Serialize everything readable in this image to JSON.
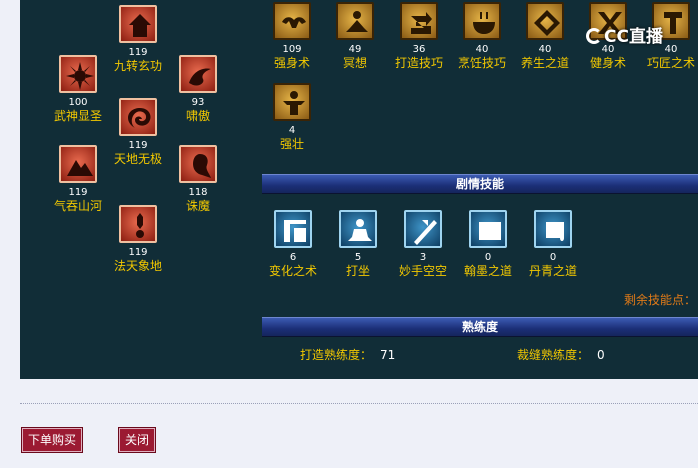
{
  "left_skills": [
    {
      "level": "119",
      "name": "九转玄功",
      "icon": "fortress-icon"
    },
    {
      "level": "100",
      "name": "武神显圣",
      "icon": "sun-burst-icon"
    },
    {
      "level": "93",
      "name": "啸傲",
      "icon": "dragon-icon"
    },
    {
      "level": "119",
      "name": "天地无极",
      "icon": "swirl-icon"
    },
    {
      "level": "119",
      "name": "气吞山河",
      "icon": "mountain-icon"
    },
    {
      "level": "118",
      "name": "诛魔",
      "icon": "ghost-icon"
    },
    {
      "level": "119",
      "name": "法天象地",
      "icon": "amulet-icon"
    }
  ],
  "life_skills": [
    {
      "level": "109",
      "name": "强身术",
      "icon": "muscle-icon"
    },
    {
      "level": "49",
      "name": "冥想",
      "icon": "meditate-icon"
    },
    {
      "level": "36",
      "name": "打造技巧",
      "icon": "forge-icon"
    },
    {
      "level": "40",
      "name": "烹饪技巧",
      "icon": "cooking-icon"
    },
    {
      "level": "40",
      "name": "养生之道",
      "icon": "health-icon"
    },
    {
      "level": "40",
      "name": "健身术",
      "icon": "fitness-icon"
    },
    {
      "level": "40",
      "name": "巧匠之术",
      "icon": "craftsman-icon"
    },
    {
      "level": "4",
      "name": "强壮",
      "icon": "strong-icon"
    }
  ],
  "story_header": "剧情技能",
  "story_skills": [
    {
      "level": "6",
      "name": "变化之术",
      "icon": "transform-icon"
    },
    {
      "level": "5",
      "name": "打坐",
      "icon": "sitting-icon"
    },
    {
      "level": "3",
      "name": "妙手空空",
      "icon": "steal-icon"
    },
    {
      "level": "0",
      "name": "翰墨之道",
      "icon": "book-icon"
    },
    {
      "level": "0",
      "name": "丹青之道",
      "icon": "scroll-icon"
    }
  ],
  "remaining_points_label": "剩余技能点：",
  "proficiency_header": "熟练度",
  "proficiency": [
    {
      "label": "打造熟练度：",
      "value": "71"
    },
    {
      "label": "裁缝熟练度：",
      "value": "0"
    }
  ],
  "watermark": "CC直播",
  "buttons": {
    "order": "下单购买",
    "close": "关闭"
  },
  "colors": {
    "panel": "#112d37",
    "skill_name": "#f2c800",
    "button": "#9b1a32",
    "remaining": "#e07a18"
  }
}
